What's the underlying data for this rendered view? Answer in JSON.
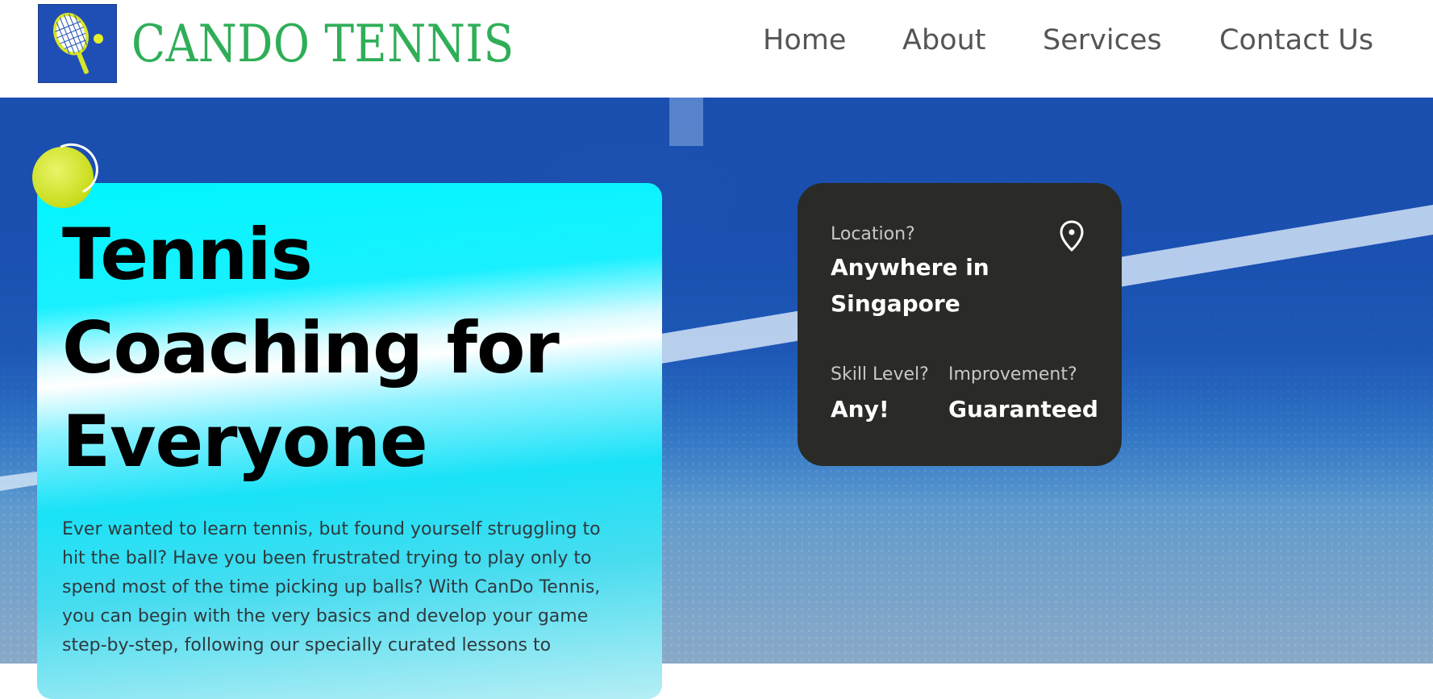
{
  "header": {
    "brand": "CANDO TENNIS",
    "logo_icon": "tennis-racket-logo",
    "nav": [
      {
        "label": "Home"
      },
      {
        "label": "About"
      },
      {
        "label": "Services"
      },
      {
        "label": "Contact Us"
      }
    ]
  },
  "hero": {
    "headline": "Tennis Coaching for Everyone",
    "intro": "Ever wanted to learn tennis, but found yourself struggling to hit the ball? Have you been frustrated trying to play only to spend most of the time picking up balls? With CanDo Tennis, you can begin with the very basics and develop your game step-by-step, following our specially curated lessons to",
    "ball_icon": "tennis-ball-icon"
  },
  "info": {
    "location_label": "Location?",
    "location_value_line1": "Anywhere in",
    "location_value_line2": "Singapore",
    "location_icon": "map-pin-icon",
    "skill_label": "Skill Level?",
    "skill_value": "Any!",
    "improvement_label": "Improvement?",
    "improvement_value": "Guaranteed"
  },
  "colors": {
    "brand_green": "#2fae58",
    "logo_blue": "#1f4fb4",
    "card_dark": "#2a2b27",
    "card_cyan": "#00f6ff",
    "ball_yellow": "#cfe21f"
  }
}
